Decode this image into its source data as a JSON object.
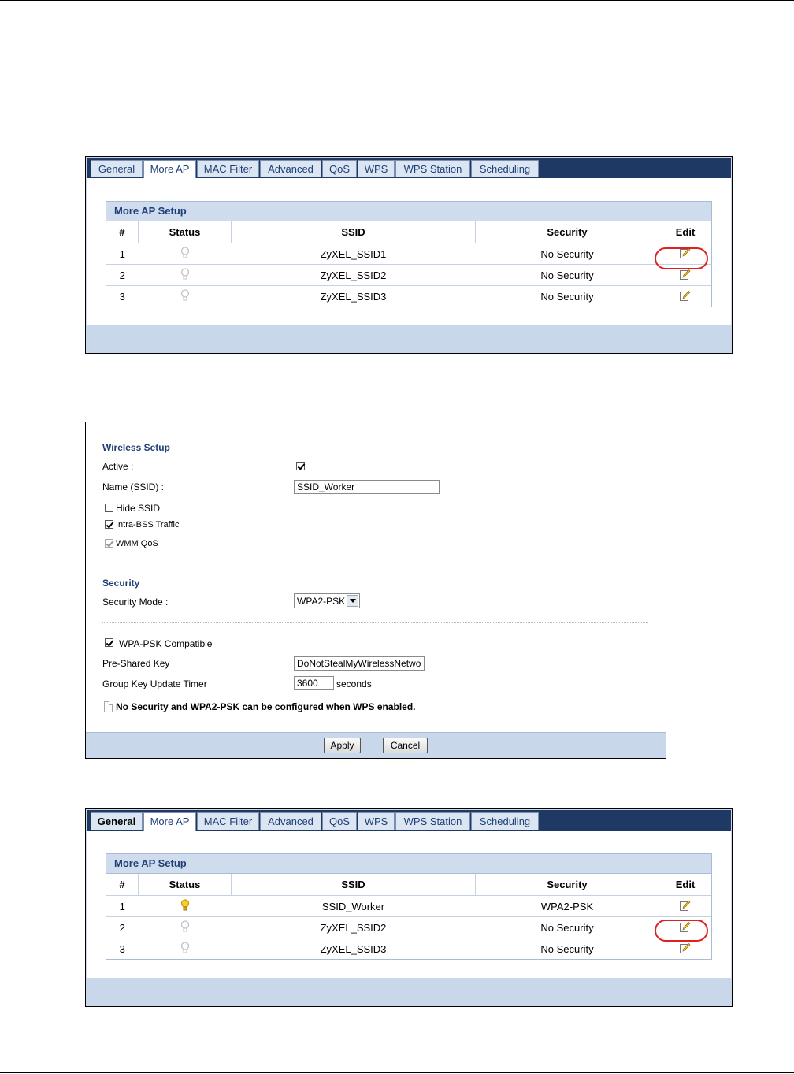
{
  "tabs": [
    "General",
    "More AP",
    "MAC Filter",
    "Advanced",
    "QoS",
    "WPS",
    "WPS Station",
    "Scheduling"
  ],
  "table_headers": [
    "#",
    "Status",
    "SSID",
    "Security",
    "Edit"
  ],
  "panel1": {
    "section_title": "More AP Setup",
    "rows": [
      {
        "num": "1",
        "ssid": "ZyXEL_SSID1",
        "security": "No Security",
        "active": false
      },
      {
        "num": "2",
        "ssid": "ZyXEL_SSID2",
        "security": "No Security",
        "active": false
      },
      {
        "num": "3",
        "ssid": "ZyXEL_SSID3",
        "security": "No Security",
        "active": false
      }
    ]
  },
  "form": {
    "wireless_setup_title": "Wireless Setup",
    "active_label": "Active :",
    "active_checked": true,
    "name_label": "Name (SSID) :",
    "name_value": "SSID_Worker",
    "hide_ssid_label": "Hide SSID",
    "hide_ssid_checked": false,
    "intra_bss_label": "Intra-BSS Traffic",
    "intra_bss_checked": true,
    "wmm_qos_label": "WMM QoS",
    "wmm_qos_checked": true,
    "security_title": "Security",
    "security_mode_label": "Security Mode :",
    "security_mode_value": "WPA2-PSK",
    "wpa_psk_compatible_label": "WPA-PSK Compatible",
    "wpa_psk_compatible_checked": true,
    "psk_label": "Pre-Shared Key",
    "psk_value": "DoNotStealMyWirelessNetwork",
    "group_key_label": "Group Key Update Timer",
    "group_key_value": "3600",
    "seconds_label": "seconds",
    "note": "No Security and WPA2-PSK can be configured when WPS enabled.",
    "apply_label": "Apply",
    "cancel_label": "Cancel"
  },
  "panel2": {
    "section_title": "More AP Setup",
    "rows": [
      {
        "num": "1",
        "ssid": "SSID_Worker",
        "security": "WPA2-PSK",
        "active": true
      },
      {
        "num": "2",
        "ssid": "ZyXEL_SSID2",
        "security": "No Security",
        "active": false
      },
      {
        "num": "3",
        "ssid": "ZyXEL_SSID3",
        "security": "No Security",
        "active": false
      }
    ]
  },
  "colors": {
    "tabbar": "#1e3a64",
    "panel_footer": "#c9d7ea",
    "section_title": "#1f3f77",
    "callout": "#e02020",
    "bulb_active": "#f2c200",
    "bulb_inactive": "#c8c8c8"
  }
}
